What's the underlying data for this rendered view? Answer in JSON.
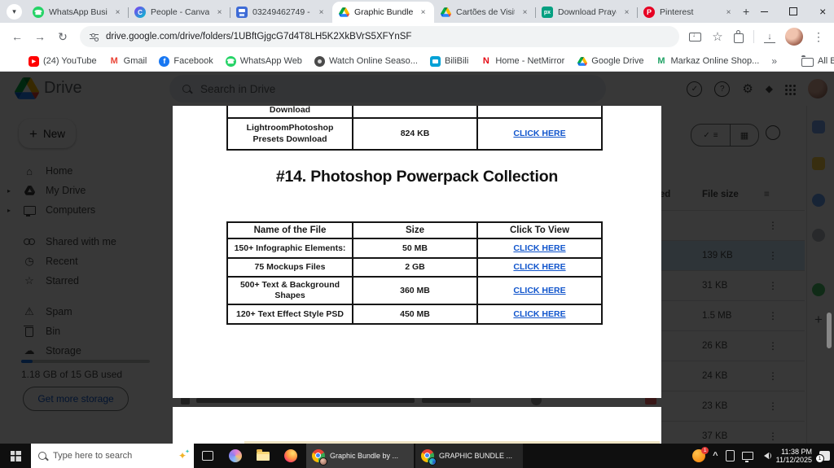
{
  "browser": {
    "tabs": [
      {
        "title": "WhatsApp Busin",
        "icon": "whatsapp"
      },
      {
        "title": "People - Canva",
        "icon": "canva"
      },
      {
        "title": "03249462749 -",
        "icon": "printer"
      },
      {
        "title": "Graphic Bundle |",
        "icon": "drive",
        "active": true
      },
      {
        "title": "Cartões de Visit",
        "icon": "drive"
      },
      {
        "title": "Download Praye",
        "icon": "pexels"
      },
      {
        "title": "Pinterest",
        "icon": "pinterest"
      }
    ],
    "url": "drive.google.com/drive/folders/1UBftGjgcG7d4T8LH5K2XkBVrS5XFYnSF",
    "bookmarks": [
      "(24) YouTube",
      "Gmail",
      "Facebook",
      "WhatsApp Web",
      "Watch Online Seaso...",
      "BiliBili",
      "Home - NetMirror",
      "Google Drive",
      "Markaz Online Shop..."
    ],
    "all_bookmarks": "All Bookmarks",
    "canva_letter": "C",
    "pexels_letters": "px",
    "pinterest_letter": "P",
    "gmail_letter": "M",
    "facebook_letter": "f",
    "netmirror_letter": "N",
    "markaz_letter": "M"
  },
  "drive": {
    "app_name": "Drive",
    "search_placeholder": "Search in Drive",
    "sidebar": {
      "new_button": "New",
      "items": [
        "Home",
        "My Drive",
        "Computers",
        "Shared with me",
        "Recent",
        "Starred",
        "Spam",
        "Bin",
        "Storage"
      ],
      "storage_text": "1.18 GB of 15 GB used",
      "get_more_button": "Get more storage"
    },
    "list": {
      "modified_col": "Modified",
      "size_col": "File size",
      "row_sizes": [
        "",
        "139 KB",
        "31 KB",
        "1.5 MB",
        "26 KB",
        "24 KB",
        "23 KB",
        "37 KB"
      ]
    }
  },
  "document": {
    "partial_row_label": "Download",
    "top_table_row": {
      "name": "LightroomPhotoshop Presets Download",
      "size": "824 KB",
      "link": "CLICK HERE"
    },
    "heading": "#14. Photoshop Powerpack Collection",
    "table": {
      "headers": [
        "Name of the File",
        "Size",
        "Click To View"
      ],
      "rows": [
        {
          "name": "150+ Infographic Elements:",
          "size": "50 MB",
          "link": "CLICK HERE"
        },
        {
          "name": "75 Mockups Files",
          "size": "2 GB",
          "link": "CLICK HERE"
        },
        {
          "name": "500+ Text & Background Shapes",
          "size": "360 MB",
          "link": "CLICK HERE"
        },
        {
          "name": "120+ Text Effect Style PSD",
          "size": "450 MB",
          "link": "CLICK HERE"
        }
      ]
    },
    "link_color": "#1155CC"
  },
  "taskbar": {
    "search_placeholder": "Type here to search",
    "tasks": [
      {
        "label": "Graphic Bundle by ..."
      },
      {
        "label": "GRAPHIC BUNDLE ..."
      }
    ],
    "tray": {
      "app_badge": "1",
      "time": "11:38 PM",
      "date": "11/12/2025",
      "notif_count": "1"
    }
  }
}
